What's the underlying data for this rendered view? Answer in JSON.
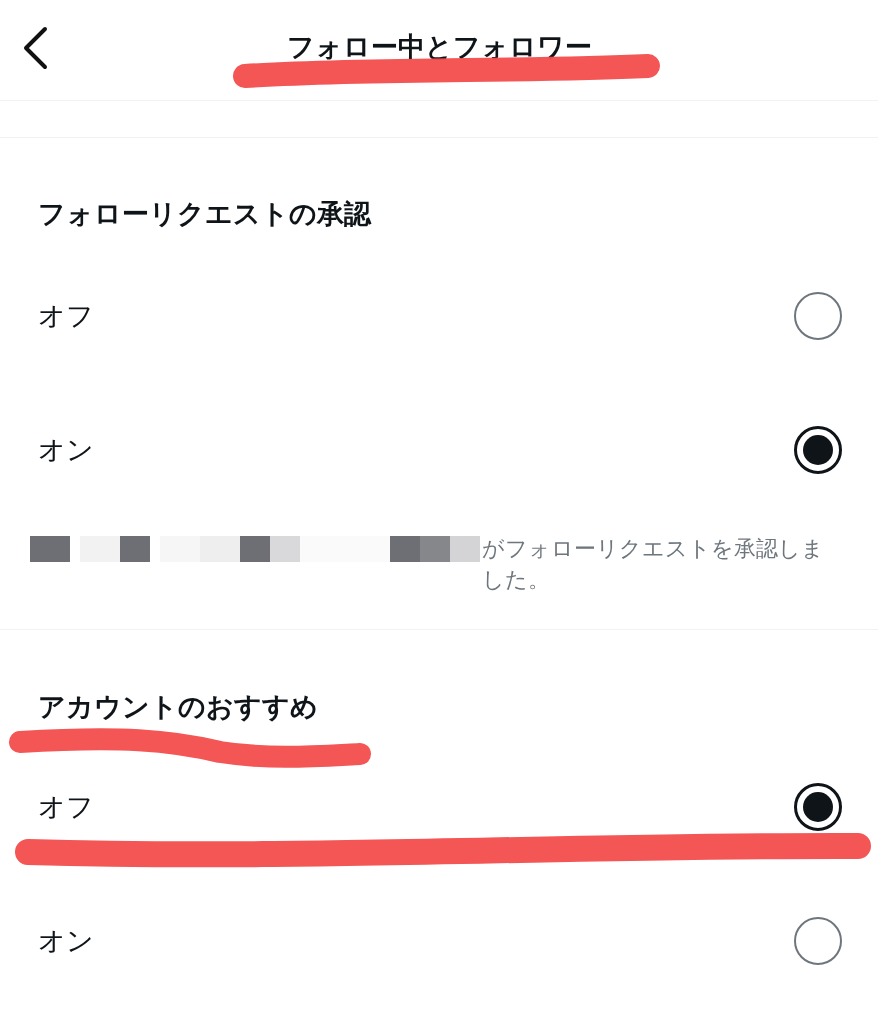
{
  "header": {
    "title": "フォロー中とフォロワー"
  },
  "sections": [
    {
      "title": "フォローリクエストの承認",
      "options": [
        {
          "label": "オフ",
          "selected": false
        },
        {
          "label": "オン",
          "selected": true
        }
      ],
      "note": "がフォローリクエストを承認しました。"
    },
    {
      "title": "アカウントのおすすめ",
      "options": [
        {
          "label": "オフ",
          "selected": true
        },
        {
          "label": "オン",
          "selected": false
        }
      ]
    }
  ]
}
